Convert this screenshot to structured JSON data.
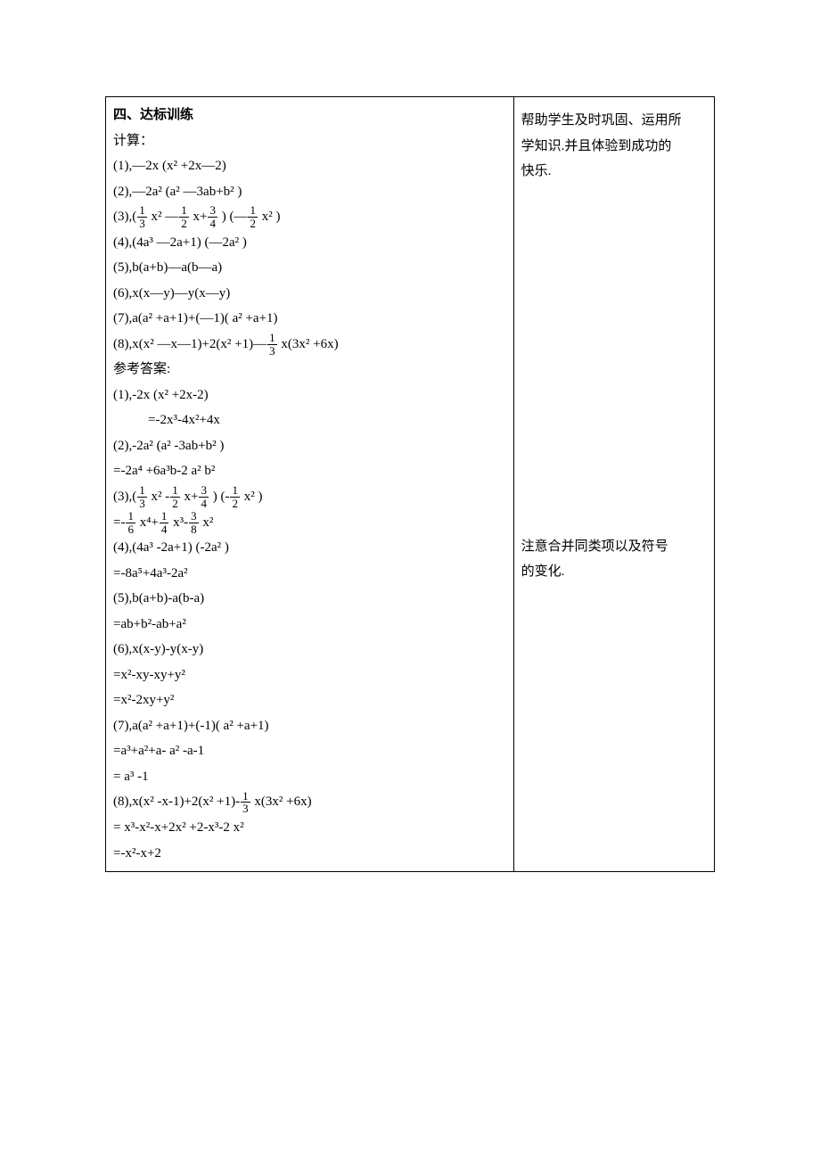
{
  "left": {
    "heading": "四、达标训练",
    "calc_label": "计算：",
    "q": {
      "q1": "(1),—2x (x² +2x—2)",
      "q2": "(2),—2a²  (a² —3ab+b² )",
      "q3_a": "(3),(",
      "q3_b": " x² —",
      "q3_c": " x+",
      "q3_d": " ) (—",
      "q3_e": " x² )",
      "q4": "(4),(4a³ —2a+1) (—2a² )",
      "q5": "(5),b(a+b)—a(b—a)",
      "q6": "(6),x(x—y)—y(x—y)",
      "q7": "(7),a(a² +a+1)+(—1)( a² +a+1)",
      "q8_a": "(8),x(x² —x—1)+2(x² +1)—",
      "q8_b": " x(3x² +6x)"
    },
    "ans_label": "参考答案:",
    "a": {
      "a1_1": "(1),-2x (x² +2x-2)",
      "a1_2": "=-2x³-4x²+4x",
      "a2_1": "(2),-2a²  (a² -3ab+b² )",
      "a2_2": "=-2a⁴ +6a³b-2 a² b²",
      "a3_1a": "(3),(",
      "a3_1b": " x² -",
      "a3_1c": " x+",
      "a3_1d": " ) (-",
      "a3_1e": " x² )",
      "a3_2a": "=-",
      "a3_2b": " x⁴+",
      "a3_2c": " x³-",
      "a3_2d": " x²",
      "a4_1": "(4),(4a³ -2a+1) (-2a² )",
      "a4_2": "=-8a⁵+4a³-2a²",
      "a5_1": "(5),b(a+b)-a(b-a)",
      "a5_2": "=ab+b²-ab+a²",
      "a6_1": "(6),x(x-y)-y(x-y)",
      "a6_2": "=x²-xy-xy+y²",
      "a6_3": "=x²-2xy+y²",
      "a7_1": "(7),a(a² +a+1)+(-1)( a² +a+1)",
      "a7_2": "=a³+a²+a- a² -a-1",
      "a7_3": "= a³ -1",
      "a8_1a": "(8),x(x² -x-1)+2(x² +1)-",
      "a8_1b": " x(3x² +6x)",
      "a8_2": "= x³-x²-x+2x² +2-x³-2 x²",
      "a8_3": "=-x²-x+2"
    }
  },
  "right": {
    "p1a": "帮助学生及时巩固、运用所",
    "p1b": "学知识.并且体验到成功的",
    "p1c": "快乐.",
    "p2a": "注意合并同类项以及符号",
    "p2b": "的变化."
  },
  "fracs": {
    "n1": "1",
    "d3": "3",
    "d2": "2",
    "n3": "3",
    "d4": "4",
    "d6": "6",
    "d8": "8"
  }
}
